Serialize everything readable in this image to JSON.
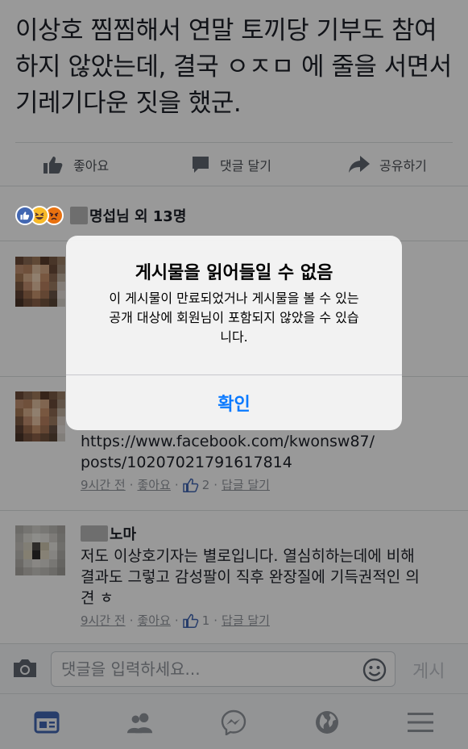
{
  "post": {
    "text": "이상호 찜찜해서 연말 토끼당 기부도 참여하지 않았는데, 결국 ㅇㅈㅁ 에 줄을 서면서 기레기다운 짓을 했군."
  },
  "actions": {
    "like": "좋아요",
    "comment": "댓글 달기",
    "share": "공유하기"
  },
  "reactions": {
    "summary": "명섭님 외 13명"
  },
  "comments": [
    {
      "link_line1": "https://www.facebook.com/kwonsw87/",
      "link_line2": "posts/10207021791617814",
      "time": "9시간 전",
      "like": "좋아요",
      "likes": "2",
      "reply": "답글 달기"
    },
    {
      "name": "노마",
      "line1": "저도 이상호기자는 별로입니다. 열심히하는데에 비해",
      "line2": "결과도 그렇고 감성팔이 직후 완장질에 기득권적인 의",
      "line3": "견 ㅎ",
      "time": "9시간 전",
      "like": "좋아요",
      "likes": "1",
      "reply": "답글 달기"
    }
  ],
  "comment_input": {
    "placeholder": "댓글을 입력하세요...",
    "post_label": "게시"
  },
  "alert": {
    "title": "게시물을 읽어들일 수 없음",
    "line1": "이 게시물이 만료되었거나 게시물을 볼 수 있는",
    "line2": "공개 대상에 회원님이 포함되지 않았을 수 있습",
    "line3": "니다.",
    "button": "확인"
  },
  "colors": {
    "accent": "#0a7aff",
    "facebook_blue": "#4267b2",
    "meta_gray": "#90949c"
  },
  "icons": [
    "thumbs-up-icon",
    "comment-icon",
    "share-icon",
    "camera-icon",
    "emoji-icon",
    "news-feed-icon",
    "friends-icon",
    "messenger-icon",
    "globe-icon",
    "menu-icon"
  ]
}
